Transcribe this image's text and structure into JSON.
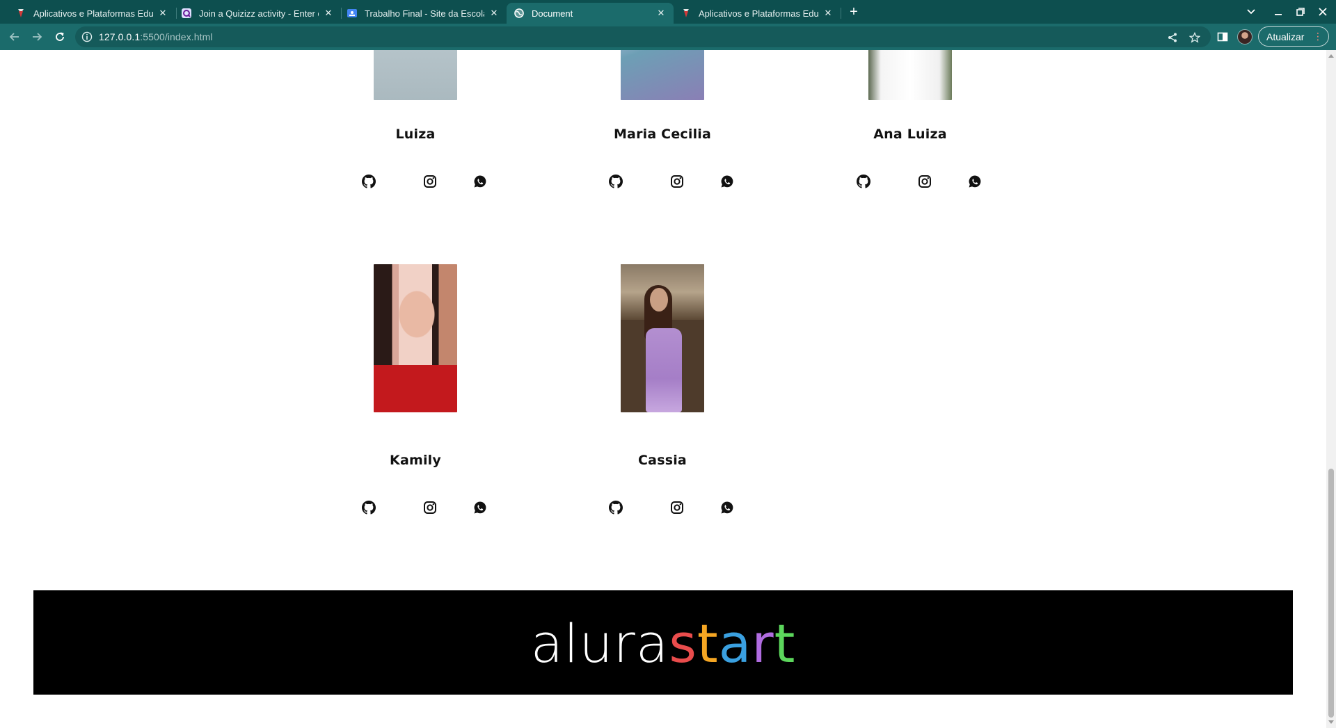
{
  "browser": {
    "tabs": [
      {
        "title": "Aplicativos e Plataformas Edu",
        "favicon": "alura-icon"
      },
      {
        "title": "Join a Quizizz activity - Enter c",
        "favicon": "quizizz-icon"
      },
      {
        "title": "Trabalho Final - Site da Escola",
        "favicon": "classroom-icon"
      },
      {
        "title": "Document",
        "favicon": "globe-icon",
        "active": true
      },
      {
        "title": "Aplicativos e Plataformas Edu",
        "favicon": "alura-icon"
      }
    ],
    "url_host": "127.0.0.1",
    "url_path": ":5500/index.html",
    "update_label": "Atualizar"
  },
  "team": [
    {
      "name": "Luiza"
    },
    {
      "name": "Maria Cecilia"
    },
    {
      "name": "Ana Luiza"
    },
    {
      "name": "Kamily"
    },
    {
      "name": "Cassia"
    }
  ],
  "footer": {
    "logo_part1": "alura",
    "logo_part2_letters": [
      "s",
      "t",
      "a",
      "r",
      "t"
    ],
    "logo_colors": [
      "#e94c4c",
      "#f5a623",
      "#3aa0e0",
      "#b06ce0",
      "#5cd65c"
    ]
  },
  "colors": {
    "tabbar": "#0d4f4f",
    "toolbar": "#1b6b6b",
    "footer_bg": "#000000"
  }
}
